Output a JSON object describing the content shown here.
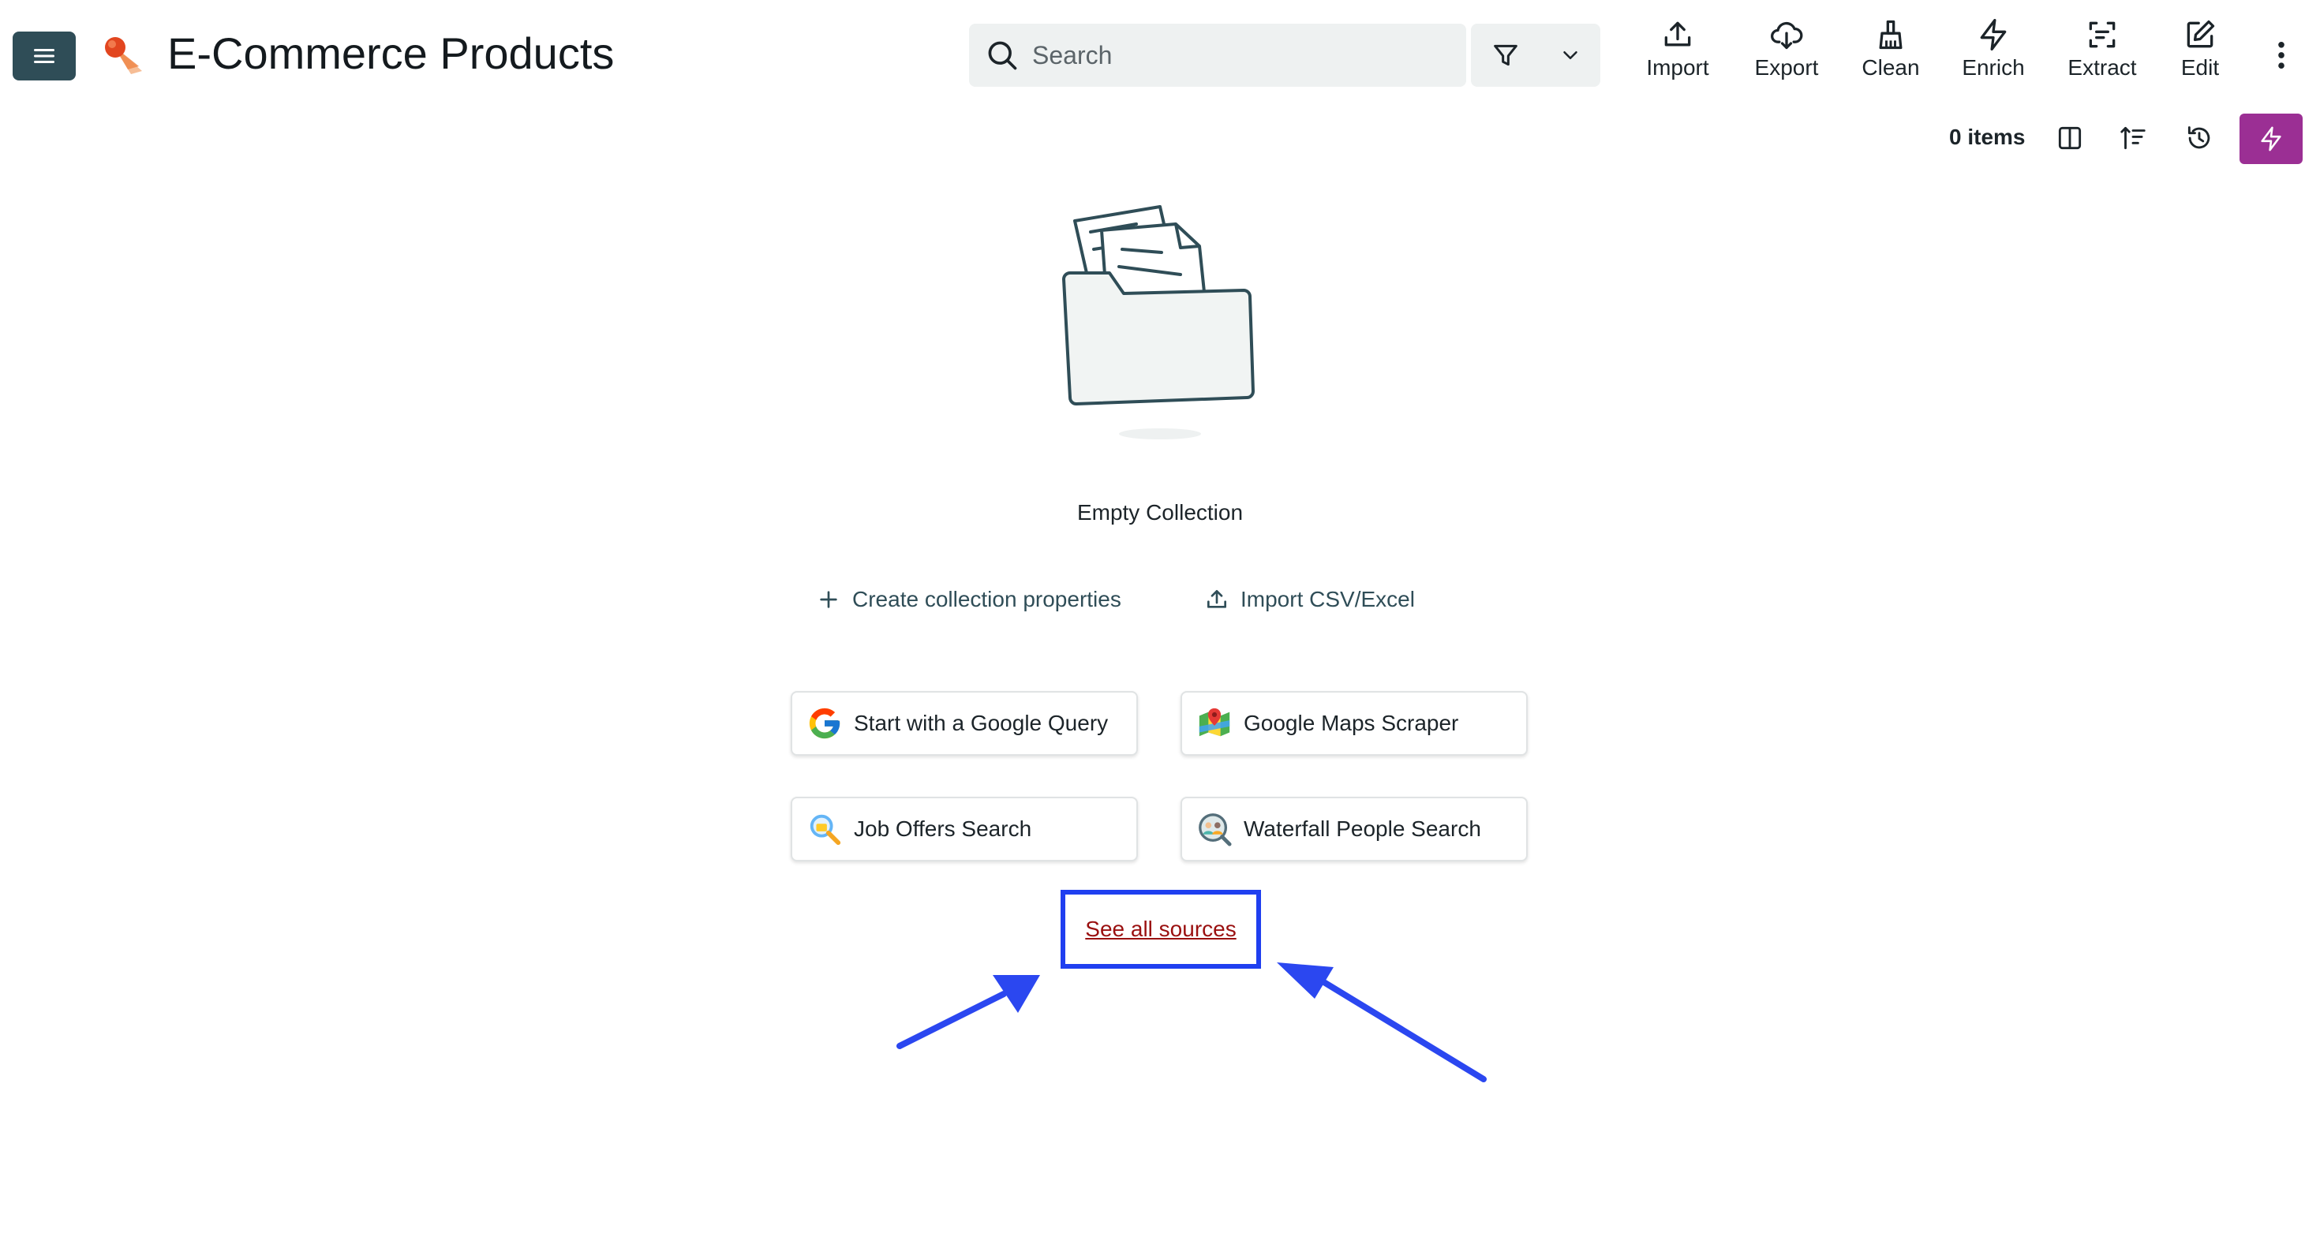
{
  "header": {
    "title": "E-Commerce Products",
    "search_placeholder": "Search",
    "tools": [
      {
        "label": "Import",
        "icon": "upload-icon"
      },
      {
        "label": "Export",
        "icon": "cloud-download-icon"
      },
      {
        "label": "Clean",
        "icon": "broom-icon"
      },
      {
        "label": "Enrich",
        "icon": "lightning-icon"
      },
      {
        "label": "Extract",
        "icon": "scan-text-icon"
      },
      {
        "label": "Edit",
        "icon": "edit-icon"
      }
    ]
  },
  "toolbar": {
    "items_count": "0 items"
  },
  "empty_state": {
    "message": "Empty Collection",
    "create_properties_label": "Create collection properties",
    "import_label": "Import CSV/Excel",
    "sources": [
      {
        "label": "Start with a Google Query",
        "icon": "google-icon"
      },
      {
        "label": "Google Maps Scraper",
        "icon": "google-maps-icon"
      },
      {
        "label": "Job Offers Search",
        "icon": "job-search-icon"
      },
      {
        "label": "Waterfall People Search",
        "icon": "people-search-icon"
      }
    ],
    "see_all_label": "See all sources"
  },
  "colors": {
    "menu_button": "#2f4d57",
    "accent_purple": "#9b2f94",
    "annotation_blue": "#1f3ff0",
    "link_red": "#9a1010"
  }
}
